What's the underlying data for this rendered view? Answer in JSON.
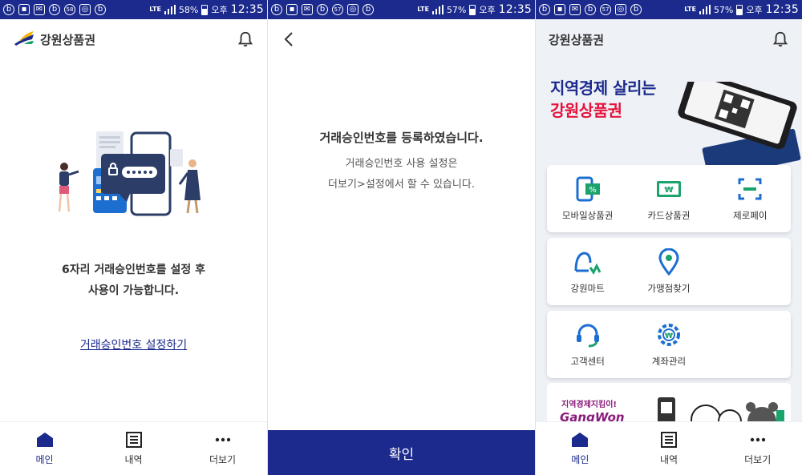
{
  "status_bars": [
    {
      "badge": "58",
      "battery": "58%",
      "period": "오후",
      "time": "12:35",
      "network": "LTE"
    },
    {
      "badge": "57",
      "battery": "57%",
      "period": "오후",
      "time": "12:35",
      "network": "LTE"
    },
    {
      "badge": "57",
      "battery": "57%",
      "period": "오후",
      "time": "12:35",
      "network": "LTE"
    }
  ],
  "screen1": {
    "brand": "강원상품권",
    "message_line1": "6자리 거래승인번호를 설정 후",
    "message_line2": "사용이 가능합니다.",
    "link": "거래승인번호 설정하기"
  },
  "screen2": {
    "title": "거래승인번호를 등록하였습니다.",
    "sub_line1": "거래승인번호 사용 설정은",
    "sub_line2": "더보기>설정에서 할 수 있습니다.",
    "confirm": "확인"
  },
  "screen3": {
    "brand": "강원상품권",
    "hero_line1": "지역경제 살리는",
    "hero_line2": "강원상품권",
    "menu_rows": [
      [
        {
          "label": "모바일상품권",
          "icon": "mobile-voucher-icon"
        },
        {
          "label": "카드상품권",
          "icon": "card-voucher-icon"
        },
        {
          "label": "제로페이",
          "icon": "zeropay-scan-icon"
        }
      ],
      [
        {
          "label": "강원마트",
          "icon": "mart-icon"
        },
        {
          "label": "가맹점찾기",
          "icon": "location-pin-icon"
        }
      ],
      [
        {
          "label": "고객센터",
          "icon": "headset-icon"
        },
        {
          "label": "계좌관리",
          "icon": "account-gear-icon"
        }
      ]
    ],
    "banner_text": "지역경제지킴이!",
    "banner_logo": "GangWon"
  },
  "nav": {
    "home": "메인",
    "history": "내역",
    "more": "더보기"
  },
  "colors": {
    "primary": "#1b2a8c",
    "accent_red": "#e6133c",
    "icon_green": "#1aa36a",
    "icon_blue": "#1c6fd1"
  }
}
